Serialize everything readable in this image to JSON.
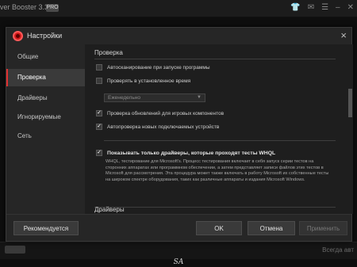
{
  "background_app": {
    "title": "ver Booster 3.3",
    "badge": "PRO",
    "icons": [
      "shirt-icon",
      "chat-icon",
      "menu-icon",
      "minimize-icon",
      "close-icon"
    ],
    "bottom_left_text": "",
    "bottom_mid_text": "",
    "bottom_right_text": "Всегда авт"
  },
  "dialog": {
    "title": "Настройки",
    "close_symbol": "×",
    "accent_color": "#e03030"
  },
  "sidebar": {
    "items": [
      {
        "label": "Общие",
        "active": false
      },
      {
        "label": "Проверка",
        "active": true
      },
      {
        "label": "Драйверы",
        "active": false
      },
      {
        "label": "Игнорируемые",
        "active": false
      },
      {
        "label": "Сеть",
        "active": false
      }
    ]
  },
  "content": {
    "section_check_title": "Проверка",
    "options": [
      {
        "label": "Автосканирование при запуске программы",
        "checked": false
      },
      {
        "label": "Проверять в установленное время",
        "checked": false
      },
      {
        "label": "Проверка обновлений для игровых компонентов",
        "checked": true
      },
      {
        "label": "Автопроверка новых подключаемых устройств",
        "checked": true
      }
    ],
    "schedule_dropdown": {
      "selected": "Еженедельно",
      "enabled": false
    },
    "whql": {
      "label": "Показывать только драйверы, которые проходят тесты WHQL",
      "checked": true,
      "description": "WHQL, тестирование для Microsoft's. Процесс тестирования включает в себя запуск серии тестов на сторонних аппаратах или программном обеспечении, а затем представляет  записи файлов этих тестов в Microsoft для рассмотрения. Эта процедура может также включать в работу Microsoft их собственные тесты на широком спектре оборудования, таких как различные аппараты и издания Microsoft Windows."
    },
    "section_drivers_title": "Драйверы"
  },
  "footer": {
    "recommended_label": "Рекомендуется",
    "ok_label": "OK",
    "cancel_label": "Отмена",
    "apply_label": "Применить"
  },
  "watermark": "SA"
}
